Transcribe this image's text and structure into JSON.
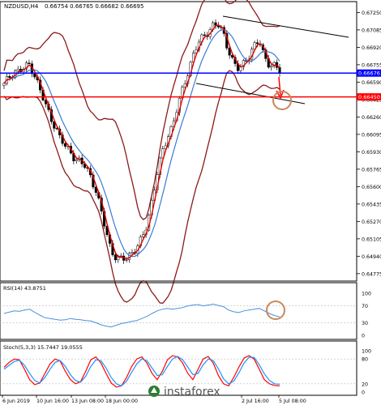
{
  "chart_data": [
    {
      "type": "candlestick",
      "symbol": "NZDUSD,H4",
      "ohlc_readout": "0.66754 0.66765 0.66682 0.66695",
      "y_ticks": [
        0.6725,
        0.67085,
        0.6692,
        0.66755,
        0.6659,
        0.66425,
        0.6626,
        0.66095,
        0.6593,
        0.65765,
        0.656,
        0.65435,
        0.6527,
        0.65105,
        0.6494,
        0.64775
      ],
      "ylim": [
        0.6472,
        0.6733
      ],
      "price_lines": [
        {
          "label": "0.66676",
          "value": 0.66676,
          "color": "#0000ff"
        },
        {
          "label": "0.66450",
          "value": 0.6645,
          "color": "#ff0000"
        }
      ],
      "close_path": [
        0.6656,
        0.6664,
        0.667,
        0.6669,
        0.6672,
        0.6676,
        0.6666,
        0.6652,
        0.6638,
        0.6628,
        0.6617,
        0.6605,
        0.6598,
        0.6594,
        0.6586,
        0.6582,
        0.6579,
        0.657,
        0.6556,
        0.6536,
        0.6518,
        0.65,
        0.6492,
        0.649,
        0.6493,
        0.6498,
        0.6501,
        0.651,
        0.6525,
        0.6548,
        0.6572,
        0.6592,
        0.6608,
        0.6618,
        0.6635,
        0.6652,
        0.6669,
        0.6684,
        0.6695,
        0.6702,
        0.6708,
        0.6713,
        0.6712,
        0.6705,
        0.669,
        0.6676,
        0.667,
        0.6678,
        0.6685,
        0.6692,
        0.6698,
        0.6684,
        0.6676,
        0.6673,
        0.66695
      ]
    },
    {
      "type": "line",
      "indicator": "RSI(14) 43.8751",
      "ylim": [
        0,
        100
      ],
      "levels": [
        30,
        70
      ],
      "values": [
        52,
        55,
        58,
        57,
        60,
        62,
        55,
        48,
        42,
        40,
        38,
        36,
        37,
        40,
        38,
        37,
        35,
        34,
        30,
        25,
        22,
        20,
        24,
        28,
        30,
        33,
        35,
        40,
        45,
        52,
        58,
        62,
        64,
        62,
        64,
        66,
        70,
        72,
        73,
        70,
        72,
        74,
        71,
        68,
        60,
        56,
        54,
        58,
        60,
        62,
        64,
        58,
        52,
        47,
        44
      ]
    },
    {
      "type": "line",
      "indicator": "Stoch(5,3,3) 15.7447 19.0555",
      "ylim": [
        0,
        100
      ],
      "levels": [
        20,
        80
      ],
      "series": [
        {
          "color": "#ff0000",
          "values": [
            60,
            72,
            80,
            78,
            55,
            30,
            18,
            22,
            45,
            68,
            80,
            75,
            50,
            30,
            20,
            25,
            50,
            78,
            85,
            70,
            45,
            22,
            12,
            15,
            35,
            62,
            80,
            85,
            70,
            45,
            30,
            50,
            78,
            88,
            85,
            70,
            45,
            30,
            55,
            80,
            86,
            70,
            40,
            20,
            15,
            35,
            60,
            82,
            88,
            80,
            55,
            30,
            20,
            16,
            15
          ]
        },
        {
          "color": "#1e90ff",
          "values": [
            55,
            65,
            74,
            77,
            65,
            45,
            28,
            22,
            35,
            55,
            72,
            76,
            62,
            42,
            28,
            24,
            38,
            62,
            78,
            76,
            58,
            35,
            20,
            15,
            26,
            48,
            68,
            80,
            76,
            58,
            40,
            42,
            62,
            80,
            86,
            78,
            60,
            42,
            45,
            66,
            80,
            76,
            56,
            32,
            20,
            26,
            46,
            70,
            84,
            84,
            66,
            44,
            28,
            20,
            19
          ]
        }
      ]
    }
  ],
  "x_axis_ticks": [
    "6 Jun 2019",
    "10 Jun 16:00",
    "13 Jun 08:00",
    "18 Jun 00:00",
    "2 Jul 16:00",
    "5 Jul 08:00"
  ],
  "watermark": "instaforex"
}
